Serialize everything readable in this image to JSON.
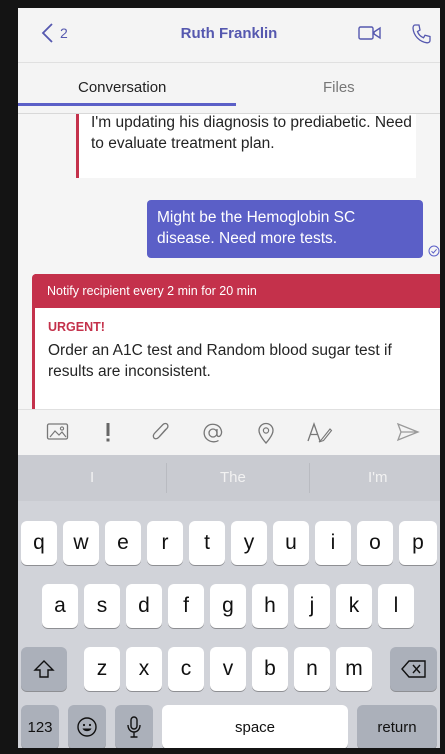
{
  "header": {
    "back_count": "2",
    "title": "Ruth Franklin"
  },
  "tabs": [
    "Conversation",
    "Files"
  ],
  "messages": {
    "incoming": "I'm updating his diagnosis to prediabetic. Need to evaluate treatment plan.",
    "outgoing": "Might be the Hemoglobin SC disease. Need more tests."
  },
  "urgent": {
    "banner": "Notify recipient every 2 min for 20 min",
    "label": "URGENT!",
    "text": "Order an A1C test and Random blood sugar test if results are inconsistent."
  },
  "keyboard": {
    "suggestions": [
      "I",
      "The",
      "I'm"
    ],
    "row1": [
      "q",
      "w",
      "e",
      "r",
      "t",
      "y",
      "u",
      "i",
      "o",
      "p"
    ],
    "row2": [
      "a",
      "s",
      "d",
      "f",
      "g",
      "h",
      "j",
      "k",
      "l"
    ],
    "row3": [
      "z",
      "x",
      "c",
      "v",
      "b",
      "n",
      "m"
    ],
    "numbers_key": "123",
    "space_key": "space",
    "return_key": "return"
  },
  "colors": {
    "accent": "#5b5fc7",
    "urgent": "#c4314b"
  }
}
